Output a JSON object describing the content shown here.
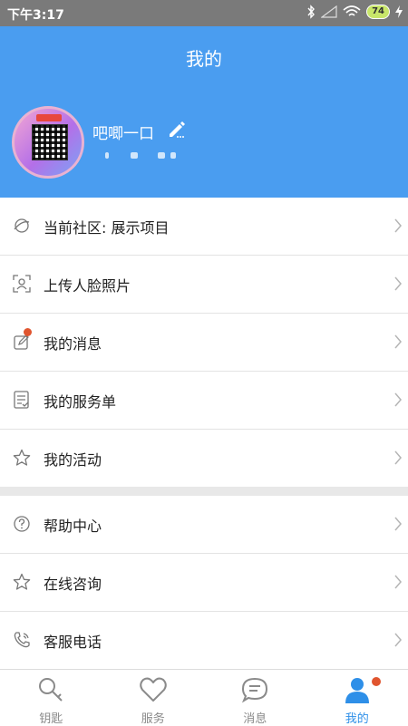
{
  "status_bar": {
    "time": "下午3:17",
    "battery": "74"
  },
  "header": {
    "title": "我的",
    "username": "吧唧一口"
  },
  "menu_group1": [
    {
      "label": "当前社区: 展示项目",
      "icon": "planet-icon"
    },
    {
      "label": "上传人脸照片",
      "icon": "face-frame-icon"
    },
    {
      "label": "我的消息",
      "icon": "edit-message-icon"
    },
    {
      "label": "我的服务单",
      "icon": "order-doc-icon"
    },
    {
      "label": "我的活动",
      "icon": "star-icon"
    }
  ],
  "menu_group2": [
    {
      "label": "帮助中心",
      "icon": "help-icon"
    },
    {
      "label": "在线咨询",
      "icon": "star-icon"
    },
    {
      "label": "客服电话",
      "icon": "phone-icon"
    }
  ],
  "tabs": [
    {
      "label": "钥匙",
      "icon": "key-icon"
    },
    {
      "label": "服务",
      "icon": "heart-icon"
    },
    {
      "label": "消息",
      "icon": "chat-icon"
    },
    {
      "label": "我的",
      "icon": "user-icon",
      "active": true
    }
  ],
  "colors": {
    "header_bg": "#4a9df0",
    "active_tab": "#2e8fe8",
    "badge": "#e0552f"
  }
}
